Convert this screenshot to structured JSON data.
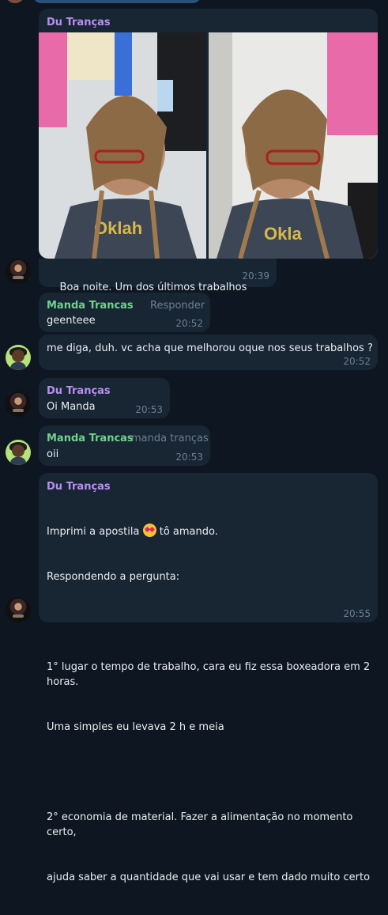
{
  "messages": [
    {
      "sender": "Du Tranças",
      "photos": [
        "hairstyle-photo-front",
        "hairstyle-photo-side"
      ],
      "text": "Boa noite. Um dos últimos trabalhos",
      "time": "20:39"
    },
    {
      "sender": "Manda Trancas",
      "reply_label": "Responder",
      "text": "geenteee",
      "time": "20:52"
    },
    {
      "text": "me diga, duh. vc acha que melhorou oque nos seus trabalhos ?",
      "time": "20:52"
    },
    {
      "sender": "Du Tranças",
      "text": "Oi Manda",
      "time": "20:53"
    },
    {
      "sender": "Manda Trancas",
      "tag": "manda tranças",
      "text": "oii",
      "time": "20:53"
    },
    {
      "sender": "Du Tranças",
      "line1": "Imprimi a apostila",
      "line1b": "tô amando.",
      "line2": "Respondendo a pergunta:",
      "line3": "1° lugar o tempo de trabalho, cara eu fiz essa boxeadora em 2 horas.",
      "line4": "Uma simples eu levava 2 h e meia",
      "line5": "2° economia de material. Fazer a alimentação no momento certo,",
      "line6": "ajuda saber a quantidade que vai usar e tem dado muito certo",
      "time": "20:55"
    }
  ],
  "colors": {
    "background": "#0e1621",
    "bubble": "#182533",
    "name_purple": "#b78ff0",
    "name_green": "#6fd38a",
    "time": "#6d7f8f"
  }
}
